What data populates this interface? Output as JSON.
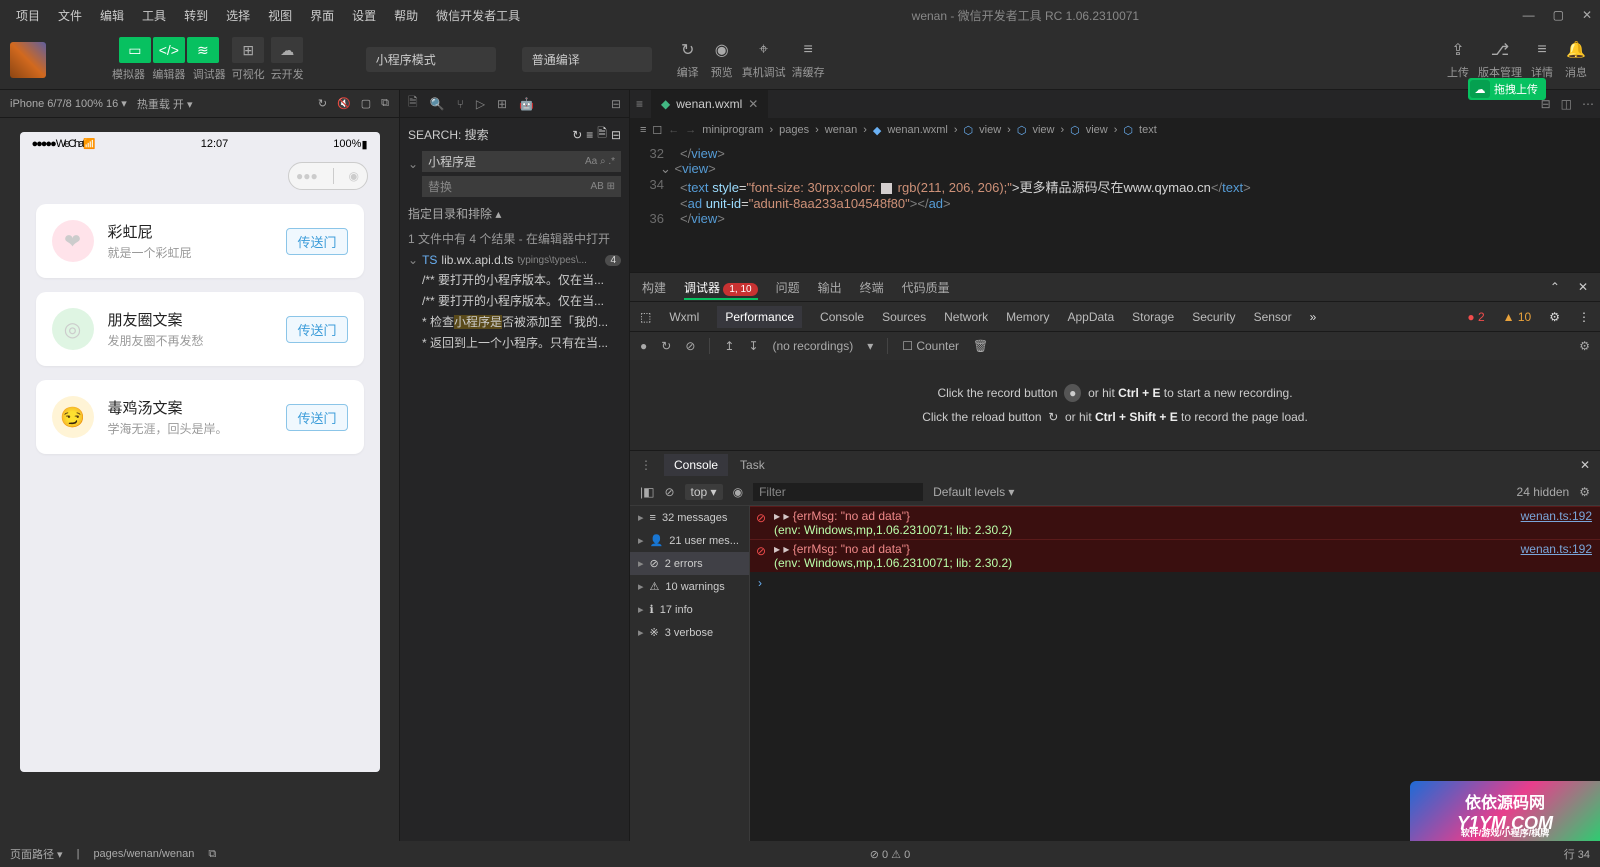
{
  "title_bar": {
    "menus": [
      "项目",
      "文件",
      "编辑",
      "工具",
      "转到",
      "选择",
      "视图",
      "界面",
      "设置",
      "帮助",
      "微信开发者工具"
    ],
    "title": "wenan - 微信开发者工具 RC 1.06.2310071"
  },
  "toolbar": {
    "groups": [
      {
        "labels": [
          "模拟器",
          "编辑器",
          "调试器"
        ],
        "green": true
      },
      {
        "labels": [
          "可视化"
        ],
        "green": false
      },
      {
        "labels": [
          "云开发"
        ],
        "green": false
      }
    ],
    "select_mode": "小程序模式",
    "select_compile": "普通编译",
    "right_icons": [
      "编译",
      "预览",
      "真机调试",
      "清缓存"
    ],
    "far_icons": [
      "上传",
      "版本管理",
      "详情",
      "消息"
    ]
  },
  "upload_pill": "拖拽上传",
  "sim": {
    "device": "iPhone 6/7/8 100% 16 ▾",
    "reload": "热重载 开 ▾",
    "status_left": "●●●●● WeChat",
    "status_time": "12:07",
    "status_right": "100%",
    "cards": [
      {
        "title": "彩虹屁",
        "sub": "就是一个彩虹屁",
        "btn": "传送门",
        "bg": "#ffe3ea",
        "emoji": "❤"
      },
      {
        "title": "朋友圈文案",
        "sub": "发朋友圈不再发愁",
        "btn": "传送门",
        "bg": "#dff5e3",
        "emoji": "◎"
      },
      {
        "title": "毒鸡汤文案",
        "sub": "学海无涯，回头是岸。",
        "btn": "传送门",
        "bg": "#fff4d6",
        "emoji": "😏"
      }
    ]
  },
  "search": {
    "label": "SEARCH: 搜索",
    "query": "小程序是",
    "replace": "替换",
    "scope": "指定目录和排除 ▴",
    "summary": "1 文件中有 4 个结果 - 在编辑器中打开",
    "file": "lib.wx.api.d.ts",
    "file_path": "typings\\types\\...",
    "file_badge": "4",
    "lines": [
      "/** 要打开的小程序版本。仅在当...",
      "/** 要打开的小程序版本。仅在当...",
      "* 检查小程序是否被添加至「我的...",
      "* 返回到上一个小程序。只有在当..."
    ]
  },
  "editor": {
    "tab": "wenan.wxml",
    "breadcrumb": [
      "miniprogram",
      "pages",
      "wenan",
      "wenan.wxml",
      "view",
      "view",
      "view",
      "text"
    ],
    "code_url": "www.qymao.cn",
    "code_text": ">更多精品源码尽在",
    "ad_unit": "adunit-8aa233a104548f80"
  },
  "devtools": {
    "tabs": [
      "构建",
      "调试器",
      "问题",
      "输出",
      "终端",
      "代码质量"
    ],
    "tabs_active_index": 1,
    "badge": "1, 10",
    "sub": [
      "Wxml",
      "Performance",
      "Console",
      "Sources",
      "Network",
      "Memory",
      "AppData",
      "Storage",
      "Security",
      "Sensor"
    ],
    "sub_active_index": 1,
    "warn_badge_err": "● 2",
    "warn_badge_warn": "▲ 10",
    "bar_text": "(no recordings)",
    "bar_counter": "Counter",
    "perf_line1_a": "Click the record button",
    "perf_line1_b": "or hit ",
    "perf_kbd1": "Ctrl + E",
    "perf_line1_c": " to start a new recording.",
    "perf_line2_a": "Click the reload button",
    "perf_line2_b": "or hit ",
    "perf_kbd2": "Ctrl + Shift + E",
    "perf_line2_c": " to record the page load."
  },
  "console": {
    "tab1": "Console",
    "tab2": "Task",
    "ctx": "top ▾",
    "filter_ph": "Filter",
    "levels": "Default levels ▾",
    "hidden": "24 hidden",
    "side": [
      {
        "icon": "≡",
        "label": "32 messages"
      },
      {
        "icon": "👤",
        "label": "21 user mes..."
      },
      {
        "icon": "⊘",
        "label": "2 errors",
        "active": true
      },
      {
        "icon": "⚠",
        "label": "10 warnings"
      },
      {
        "icon": "ℹ",
        "label": "17 info"
      },
      {
        "icon": "※",
        "label": "3 verbose"
      }
    ],
    "logs": [
      {
        "msg": "{errMsg: \"no ad data\"}",
        "env": "(env: Windows,mp,1.06.2310071; lib: 2.30.2)",
        "link": "wenan.ts:192"
      },
      {
        "msg": "{errMsg: \"no ad data\"}",
        "env": "(env: Windows,mp,1.06.2310071; lib: 2.30.2)",
        "link": "wenan.ts:192"
      }
    ]
  },
  "status": {
    "path_label": "页面路径 ▾",
    "path": "pages/wenan/wenan",
    "err_warn": "⊘ 0 ⚠ 0",
    "right1": "行 34",
    "right2": "软件/游戏/小程序/棋牌"
  },
  "watermark": {
    "l1": "依依源码网",
    "l2": "Y1YM.COM"
  }
}
